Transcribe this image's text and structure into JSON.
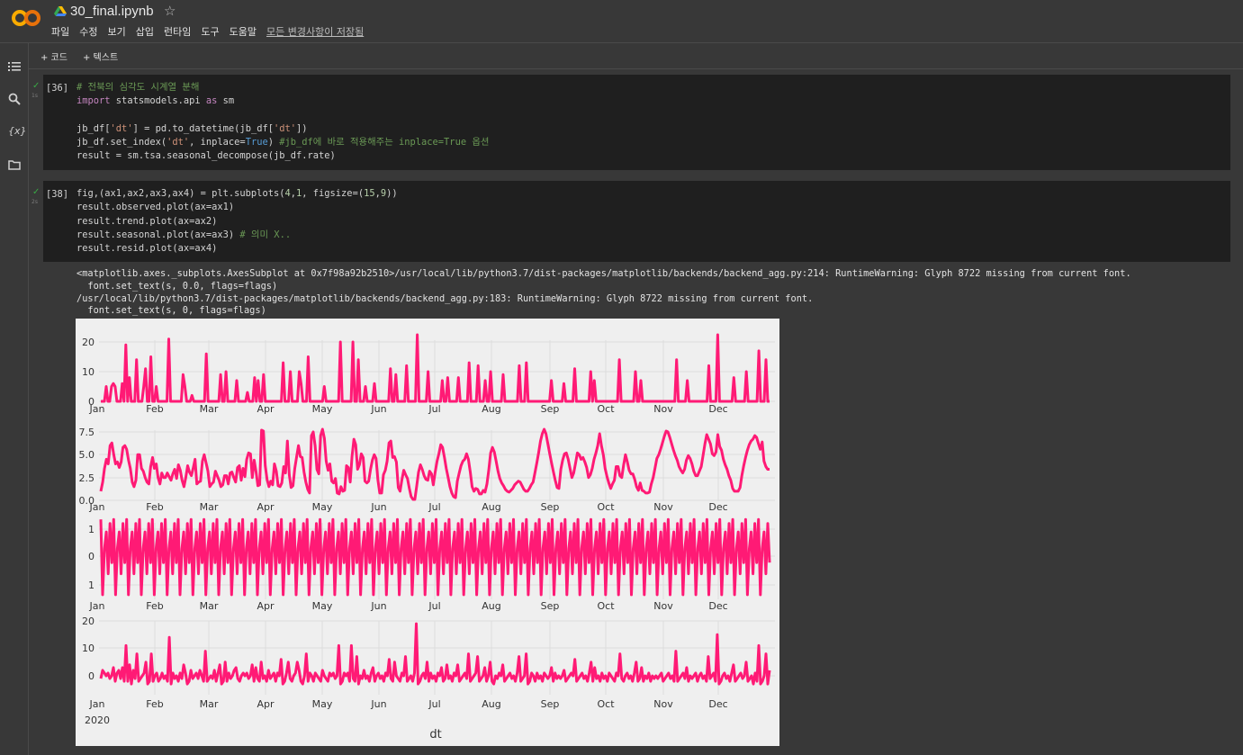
{
  "header": {
    "notebook_title": "30_final.ipynb",
    "star_icon": "☆",
    "menu": [
      "파일",
      "수정",
      "보기",
      "삽입",
      "런타임",
      "도구",
      "도움말"
    ],
    "save_status": "모든 변경사항이 저장됨"
  },
  "toolbar": {
    "add_code": "+ 코드",
    "add_text": "+ 텍스트"
  },
  "sidebar": {
    "icons": [
      "table-of-contents-icon",
      "search-icon",
      "variables-icon",
      "files-icon"
    ],
    "variables_glyph": "{x}"
  },
  "cells": [
    {
      "prompt": "[36]",
      "status": "✓",
      "time": "1s",
      "lines": [
        "# 전북의 심각도 시계열 분해",
        "import statsmodels.api as sm",
        "",
        "jb_df['dt'] = pd.to_datetime(jb_df['dt'])",
        "jb_df.set_index('dt', inplace=True) #jb_df에 바로 적용해주는 inplace=True 옵션",
        "result = sm.tsa.seasonal_decompose(jb_df.rate)"
      ]
    },
    {
      "prompt": "[38]",
      "status": "✓",
      "time": "2s",
      "lines": [
        "fig,(ax1,ax2,ax3,ax4) = plt.subplots(4,1, figsize=(15,9))",
        "result.observed.plot(ax=ax1)",
        "result.trend.plot(ax=ax2)",
        "result.seasonal.plot(ax=ax3) # 의미 X..",
        "result.resid.plot(ax=ax4)"
      ]
    }
  ],
  "output_text": [
    "<matplotlib.axes._subplots.AxesSubplot at 0x7f98a92b2510>/usr/local/lib/python3.7/dist-packages/matplotlib/backends/backend_agg.py:214: RuntimeWarning: Glyph 8722 missing from current font.",
    "  font.set_text(s, 0.0, flags=flags)",
    "/usr/local/lib/python3.7/dist-packages/matplotlib/backends/backend_agg.py:183: RuntimeWarning: Glyph 8722 missing from current font.",
    "  font.set_text(s, 0, flags=flags)"
  ],
  "chart_data": {
    "type": "line",
    "line_color": "#ff1a75",
    "background": "#efefef",
    "xlabel": "dt",
    "x_tick_labels": [
      "Jan",
      "Feb",
      "Mar",
      "Apr",
      "May",
      "Jun",
      "Jul",
      "Aug",
      "Sep",
      "Oct",
      "Nov",
      "Dec"
    ],
    "x_year_label": "2020",
    "grid": true,
    "panels": [
      {
        "name": "observed",
        "yticks": [
          "20",
          "10",
          "0"
        ],
        "ylim": [
          -1,
          25
        ],
        "values": [
          0,
          0,
          0,
          5,
          0,
          0,
          5,
          6,
          5,
          0,
          0,
          0,
          6,
          0,
          19,
          0,
          8,
          0,
          0,
          0,
          14,
          0,
          0,
          0,
          5,
          11,
          0,
          0,
          15,
          0,
          0,
          5,
          0,
          0,
          0,
          0,
          0,
          0,
          21,
          0,
          0,
          0,
          0,
          0,
          0,
          0,
          9,
          5,
          0,
          0,
          0,
          2,
          0,
          0,
          0,
          0,
          0,
          0,
          0,
          16,
          0,
          0,
          0,
          0,
          0,
          0,
          0,
          9,
          0,
          0,
          10,
          0,
          0,
          0,
          0,
          0,
          7,
          0,
          0,
          0,
          0,
          0,
          3,
          0,
          0,
          0,
          8,
          0,
          7,
          0,
          0,
          9,
          0,
          0,
          0,
          0,
          0,
          0,
          0,
          0,
          0,
          0,
          13,
          0,
          0,
          0,
          10,
          0,
          0,
          0,
          0,
          10,
          6,
          0,
          0,
          0,
          15,
          0,
          0,
          0,
          0,
          0,
          0,
          0,
          0,
          5,
          0,
          0,
          0,
          0,
          0,
          0,
          0,
          0,
          20,
          0,
          0,
          0,
          0,
          0,
          0,
          20,
          0,
          0,
          14,
          0,
          0,
          0,
          5,
          0,
          0,
          0,
          0,
          6,
          0,
          0,
          0,
          0,
          0,
          0,
          0,
          0,
          11,
          0,
          0,
          9,
          0,
          0,
          0,
          0,
          0,
          12,
          0,
          0,
          0,
          0,
          0,
          25,
          0,
          0,
          0,
          0,
          0,
          10,
          0,
          0,
          0,
          0,
          0,
          0,
          0,
          7,
          0,
          0,
          8,
          0,
          0,
          0,
          0,
          0,
          8,
          0,
          0,
          0,
          0,
          0,
          13,
          0,
          0,
          0,
          0,
          12,
          0,
          0,
          0,
          7,
          0,
          0,
          10,
          0,
          0,
          0,
          0,
          0,
          0,
          9,
          0,
          0,
          0,
          0,
          0,
          0,
          0,
          0,
          12,
          0,
          0,
          0,
          13,
          0,
          0,
          0,
          0,
          0,
          0,
          0,
          0,
          0,
          0,
          0,
          0,
          0,
          7,
          0,
          0,
          0,
          0,
          0,
          0,
          6,
          0,
          0,
          0,
          0,
          0,
          11,
          0,
          0,
          0,
          0,
          0,
          0,
          0,
          0,
          10,
          0,
          7,
          0,
          0,
          0,
          0,
          0,
          0,
          0,
          0,
          0,
          0,
          0,
          0,
          0,
          14,
          0,
          0,
          0,
          0,
          0,
          0,
          0,
          0,
          10,
          0,
          0,
          7,
          0,
          0,
          0,
          0,
          0,
          0,
          0,
          0,
          0,
          0,
          0,
          0,
          0,
          0,
          0,
          0,
          0,
          0,
          0,
          14,
          0,
          0,
          0,
          0,
          0,
          7,
          0,
          0,
          0,
          0,
          0,
          0,
          0,
          0,
          0,
          0,
          0,
          12,
          0,
          0,
          0,
          0,
          25,
          0,
          0,
          0,
          0,
          0,
          0,
          0,
          0,
          8,
          0,
          0,
          0,
          0,
          0,
          0,
          10,
          0,
          0,
          0,
          0,
          0,
          0,
          17,
          0,
          0,
          0,
          14,
          0,
          0
        ]
      },
      {
        "name": "trend",
        "yticks": [
          "7.5",
          "5.0",
          "2.5",
          "0.0"
        ],
        "ylim": [
          0,
          8
        ],
        "values": [
          1,
          2,
          3.5,
          4.5,
          4,
          6,
          6.3,
          5,
          4,
          4.2,
          3.6,
          4.2,
          5.8,
          6,
          5.6,
          4.4,
          3.5,
          2,
          1.5,
          2.2,
          5,
          5,
          3.5,
          3.2,
          2.5,
          2,
          1.8,
          3.7,
          4.7,
          3.5,
          4,
          2.5,
          1.8,
          3,
          2.5,
          2.5,
          3,
          2.6,
          2.2,
          2.9,
          3.4,
          2.4,
          3.9,
          3.3,
          2.2,
          1.5,
          2.5,
          3.8,
          3.1,
          2.7,
          3.5,
          4.5,
          1.8,
          2,
          2.1,
          4.3,
          5,
          4.1,
          3.2,
          1.5,
          1.8,
          2,
          3.2,
          2.7,
          2.2,
          1.5,
          1.7,
          2.7,
          2.7,
          1.8,
          3,
          3.1,
          2.5,
          2,
          3.6,
          3.8,
          2.2,
          3.5,
          2.6,
          4.5,
          5.2,
          5.1,
          2.5,
          4.4,
          3.2,
          1.6,
          1.7,
          7.7,
          7.6,
          3.8,
          2.3,
          1.5,
          2.1,
          1.7,
          4,
          3.2,
          1.6,
          1.5,
          1.9,
          3.7,
          3,
          6.5,
          2.8,
          1.4,
          1.6,
          3.5,
          4.8,
          6,
          4.8,
          4.7,
          3.1,
          2,
          1.2,
          0.8,
          7.1,
          7.5,
          6,
          3.4,
          2.9,
          7.1,
          7.8,
          6.8,
          4.3,
          3.3,
          4,
          2.1,
          1.9,
          2.4,
          0.8,
          0.7,
          1.5,
          1,
          1.1,
          3.8,
          3.6,
          2,
          4.8,
          6.7,
          6.1,
          3.4,
          3.9,
          5.1,
          4.7,
          2.1,
          1.9,
          2.1,
          3.4,
          4.4,
          5,
          4.6,
          2.2,
          0.8,
          0.8,
          2.8,
          3.3,
          4.3,
          6.3,
          6.5,
          4.7,
          4.8,
          4.2,
          1.4,
          1,
          2.3,
          3.3,
          2.8,
          2.4,
          1.3,
          0.4,
          0.1,
          0.1,
          1.6,
          3.1,
          3.9,
          3.4,
          2.7,
          2.3,
          2.2,
          3.2,
          2.9,
          1.7,
          3.1,
          4.3,
          5.1,
          6.1,
          5.8,
          4.7,
          3.5,
          2.5,
          1.5,
          0.8,
          0.4,
          0.3,
          2.1,
          3,
          3.8,
          4.3,
          4.5,
          5.1,
          4.5,
          3.1,
          1.5,
          1,
          1.3,
          1.2,
          0.7,
          0.7,
          1.1,
          0.9,
          1.8,
          3.3,
          5.2,
          5.8,
          5.3,
          4.3,
          3.2,
          2.4,
          1.9,
          1.6,
          1.2,
          1,
          0.9,
          1.1,
          1.3,
          1.7,
          1.9,
          2.1,
          2,
          1.6,
          1.2,
          1,
          1,
          1.3,
          1.7,
          2,
          3,
          4.1,
          5.2,
          6.5,
          7.3,
          7.8,
          7.3,
          6.2,
          5.1,
          4.1,
          3.1,
          2.2,
          1.4,
          1.3,
          3.4,
          4.4,
          5.1,
          5.2,
          4.5,
          3.5,
          2.5,
          3,
          4.1,
          5.2,
          5,
          4.5,
          4.7,
          4.2,
          3.6,
          2.5,
          2.8,
          3.5,
          4.5,
          5.2,
          6,
          7.3,
          6,
          5,
          3.5,
          2.6,
          1.9,
          1.3,
          1.8,
          2.2,
          3.7,
          3.7,
          2.7,
          2.5,
          3.9,
          5,
          4.2,
          3.3,
          2.9,
          2.9,
          2.3,
          1.5,
          1.1,
          1.9,
          1.1,
          1,
          0.8,
          0.8,
          0.9,
          1.8,
          2.5,
          3.5,
          4.6,
          5,
          5.6,
          6.3,
          7,
          7.6,
          7.5,
          6.9,
          6.2,
          5.5,
          4.9,
          4.4,
          3.7,
          3.3,
          3,
          3.4,
          4.4,
          4.9,
          4.6,
          4,
          3.2,
          2.7,
          2.7,
          3.2,
          3.7,
          4.9,
          6.2,
          7.2,
          6.7,
          6.2,
          5.1,
          4.9,
          5.3,
          7.2,
          5.9,
          5.5,
          4.5,
          3.9,
          3.4,
          2.7,
          2.2,
          1.3,
          1,
          1,
          1,
          1.4,
          2.7,
          3.8,
          4.7,
          5.5,
          6.1,
          6.5,
          6.7,
          7.1,
          6.9,
          6.2,
          5.6,
          6.4,
          4.3,
          3.7,
          3.4,
          3.4
        ]
      },
      {
        "name": "seasonal",
        "yticks": [
          "1",
          "0",
          "1"
        ],
        "ylim": [
          -1.4,
          1.4
        ],
        "period_points": 7,
        "pattern": [
          1.35,
          -1.35,
          0.3,
          0.9,
          -0.6,
          1.2,
          -0.2
        ],
        "repeats": 52
      },
      {
        "name": "resid",
        "yticks": [
          "20",
          "10",
          "0"
        ],
        "ylim": [
          -6,
          20
        ],
        "values": [
          -1,
          2,
          1,
          0,
          1,
          -1,
          0,
          3,
          -2,
          1,
          2,
          -1,
          3,
          -2,
          11,
          -2,
          4,
          -3,
          2,
          -1,
          8,
          -2,
          -1,
          0,
          1,
          5,
          -3,
          -2,
          8,
          -2,
          0,
          1,
          -2,
          -1,
          1,
          -1,
          0,
          -2,
          14,
          -3,
          1,
          -1,
          0,
          -2,
          1,
          -1,
          4,
          1,
          -3,
          -2,
          2,
          -1,
          0,
          1,
          -1,
          2,
          0,
          -2,
          9,
          -2,
          -1,
          0,
          -1,
          2,
          -2,
          1,
          4,
          -3,
          -2,
          5,
          -2,
          1,
          -1,
          0,
          2,
          3,
          -1,
          -2,
          0,
          1,
          0,
          1,
          -1,
          0,
          4,
          -2,
          3,
          -1,
          -2,
          5,
          -1,
          0,
          -2,
          2,
          -1,
          0,
          1,
          -2,
          1,
          0,
          6,
          -3,
          -2,
          1,
          5,
          -1,
          -2,
          0,
          1,
          5,
          2,
          -2,
          -3,
          0,
          8,
          -2,
          1,
          0,
          -2,
          1,
          0,
          -1,
          -2,
          2,
          0,
          -1,
          -2,
          1,
          0,
          1,
          -1,
          0,
          11,
          -3,
          -2,
          1,
          0,
          1,
          -2,
          11,
          -1,
          -2,
          7,
          -3,
          0,
          -1,
          2,
          -1,
          0,
          -2,
          1,
          3,
          -2,
          0,
          1,
          -1,
          0,
          -2,
          1,
          0,
          6,
          -1,
          -2,
          5,
          0,
          -1,
          -2,
          1,
          0,
          7,
          -2,
          -1,
          0,
          -2,
          1,
          19,
          -3,
          -2,
          0,
          1,
          -1,
          5,
          -2,
          1,
          -1,
          0,
          -2,
          1,
          0,
          3,
          -2,
          -1,
          4,
          -1,
          0,
          -2,
          1,
          0,
          4,
          -2,
          -1,
          0,
          1,
          -1,
          8,
          -2,
          -1,
          0,
          1,
          7,
          -2,
          -1,
          0,
          3,
          -2,
          0,
          5,
          -2,
          -3,
          0,
          -1,
          1,
          0,
          4,
          -2,
          -1,
          0,
          1,
          -1,
          0,
          -2,
          1,
          7,
          -2,
          -1,
          0,
          8,
          -3,
          -2,
          1,
          0,
          -2,
          1,
          -1,
          0,
          -2,
          1,
          0,
          -1,
          0,
          3,
          -2,
          1,
          -1,
          0,
          -1,
          0,
          2,
          -2,
          -1,
          0,
          1,
          0,
          6,
          -2,
          -1,
          0,
          1,
          -1,
          0,
          -2,
          1,
          5,
          -2,
          3,
          -1,
          0,
          -2,
          1,
          -1,
          0,
          -2,
          1,
          0,
          -1,
          -2,
          1,
          0,
          8,
          -1,
          -2,
          0,
          1,
          -1,
          0,
          -2,
          1,
          5,
          -2,
          -1,
          3,
          -2,
          0,
          -1,
          1,
          -2,
          0,
          -1,
          0,
          -1,
          0,
          1,
          -2,
          -1,
          0,
          1,
          -1,
          0,
          -2,
          9,
          -2,
          -1,
          0,
          1,
          -1,
          3,
          -2,
          0,
          -1,
          0,
          1,
          -2,
          0,
          1,
          -1,
          0,
          -2,
          7,
          -1,
          0,
          1,
          -2,
          15,
          -3,
          -2,
          0,
          1,
          -1,
          0,
          -2,
          1,
          4,
          -2,
          -1,
          0,
          1,
          -1,
          0,
          5,
          -2,
          -1,
          0,
          -3,
          1,
          -2,
          11,
          -3,
          -2,
          0,
          8,
          -3,
          2
        ]
      }
    ]
  }
}
